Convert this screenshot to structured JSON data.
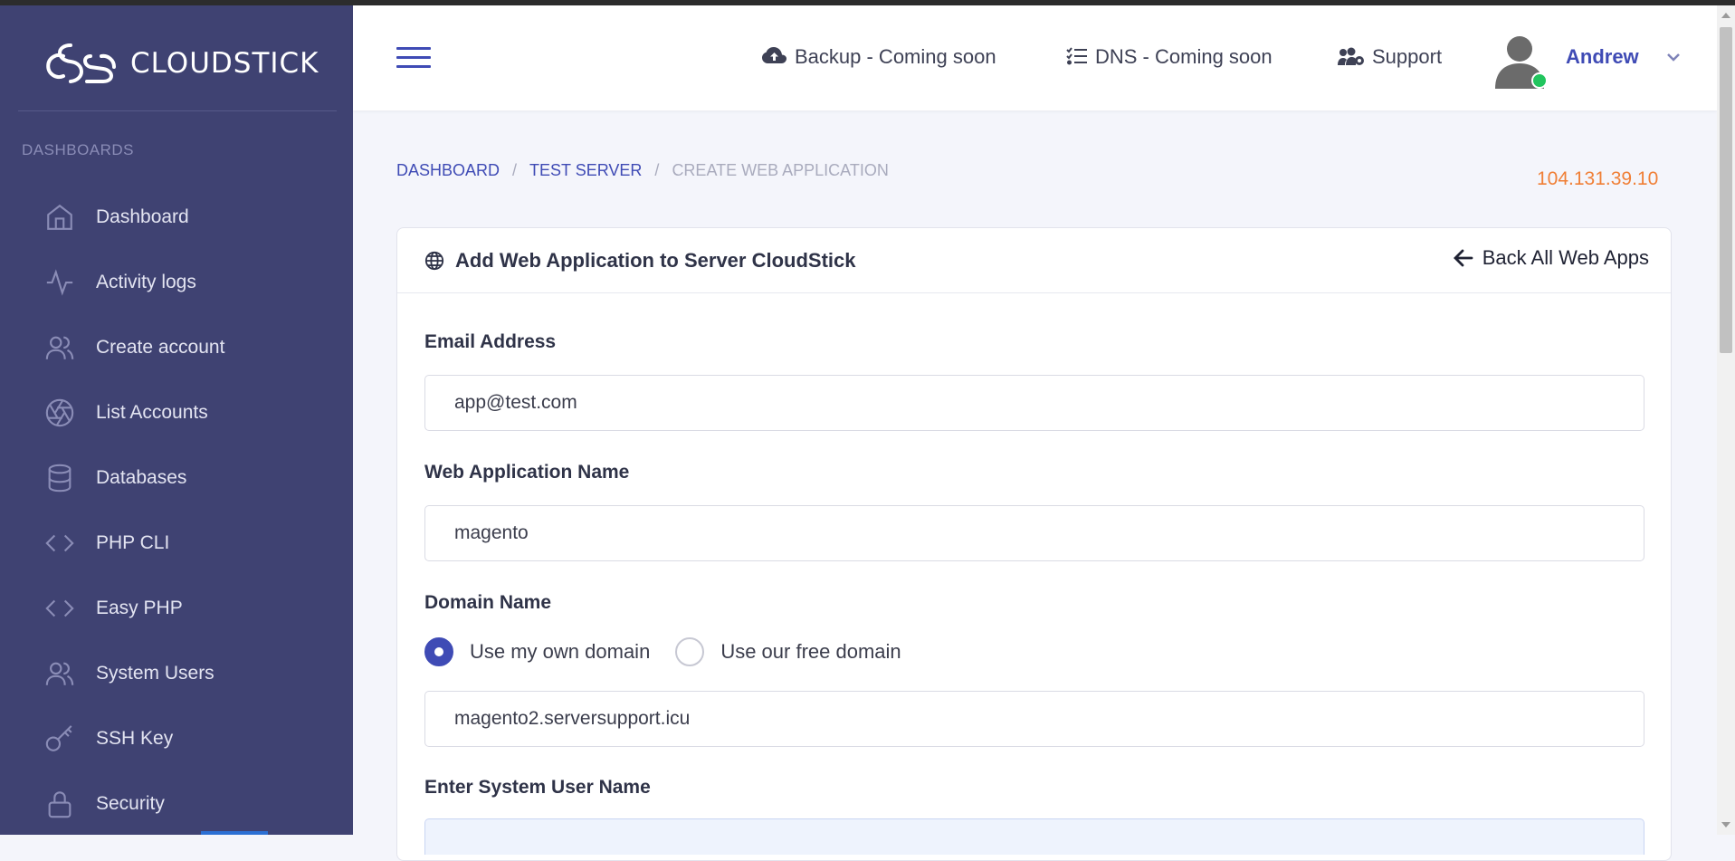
{
  "brand": {
    "name": "CLOUDSTICK"
  },
  "sidebar": {
    "section": "DASHBOARDS",
    "items": [
      {
        "label": "Dashboard",
        "icon": "home-icon"
      },
      {
        "label": "Activity logs",
        "icon": "activity-icon"
      },
      {
        "label": "Create account",
        "icon": "users-icon"
      },
      {
        "label": "List Accounts",
        "icon": "aperture-icon"
      },
      {
        "label": "Databases",
        "icon": "database-icon"
      },
      {
        "label": "PHP CLI",
        "icon": "code-icon"
      },
      {
        "label": "Easy PHP",
        "icon": "code-icon"
      },
      {
        "label": "System Users",
        "icon": "users-icon"
      },
      {
        "label": "SSH Key",
        "icon": "key-icon"
      },
      {
        "label": "Security",
        "icon": "lock-icon"
      }
    ]
  },
  "header": {
    "links": [
      {
        "label": "Backup - Coming soon",
        "icon": "cloud-upload-icon"
      },
      {
        "label": "DNS - Coming soon",
        "icon": "list-check-icon"
      },
      {
        "label": "Support",
        "icon": "users-cog-icon"
      }
    ],
    "user": {
      "name": "Andrew",
      "status_color": "#22c55e"
    }
  },
  "breadcrumb": {
    "items": [
      "DASHBOARD",
      "TEST SERVER"
    ],
    "current": "CREATE WEB APPLICATION",
    "separator": "/"
  },
  "server_ip": "104.131.39.10",
  "card": {
    "title": "Add Web Application to Server CloudStick",
    "back_label": "Back All Web Apps",
    "fields": {
      "email": {
        "label": "Email Address",
        "value": "app@test.com"
      },
      "app_name": {
        "label": "Web Application Name",
        "value": "magento"
      },
      "domain": {
        "label": "Domain Name",
        "options": [
          "Use my own domain",
          "Use our free domain"
        ],
        "selected": "Use my own domain",
        "value": "magento2.serversupport.icu"
      },
      "system_user": {
        "label": "Enter System User Name"
      }
    }
  },
  "colors": {
    "sidebar_bg": "#3f4272",
    "accent": "#3f4bb5",
    "ip": "#f07f36"
  }
}
